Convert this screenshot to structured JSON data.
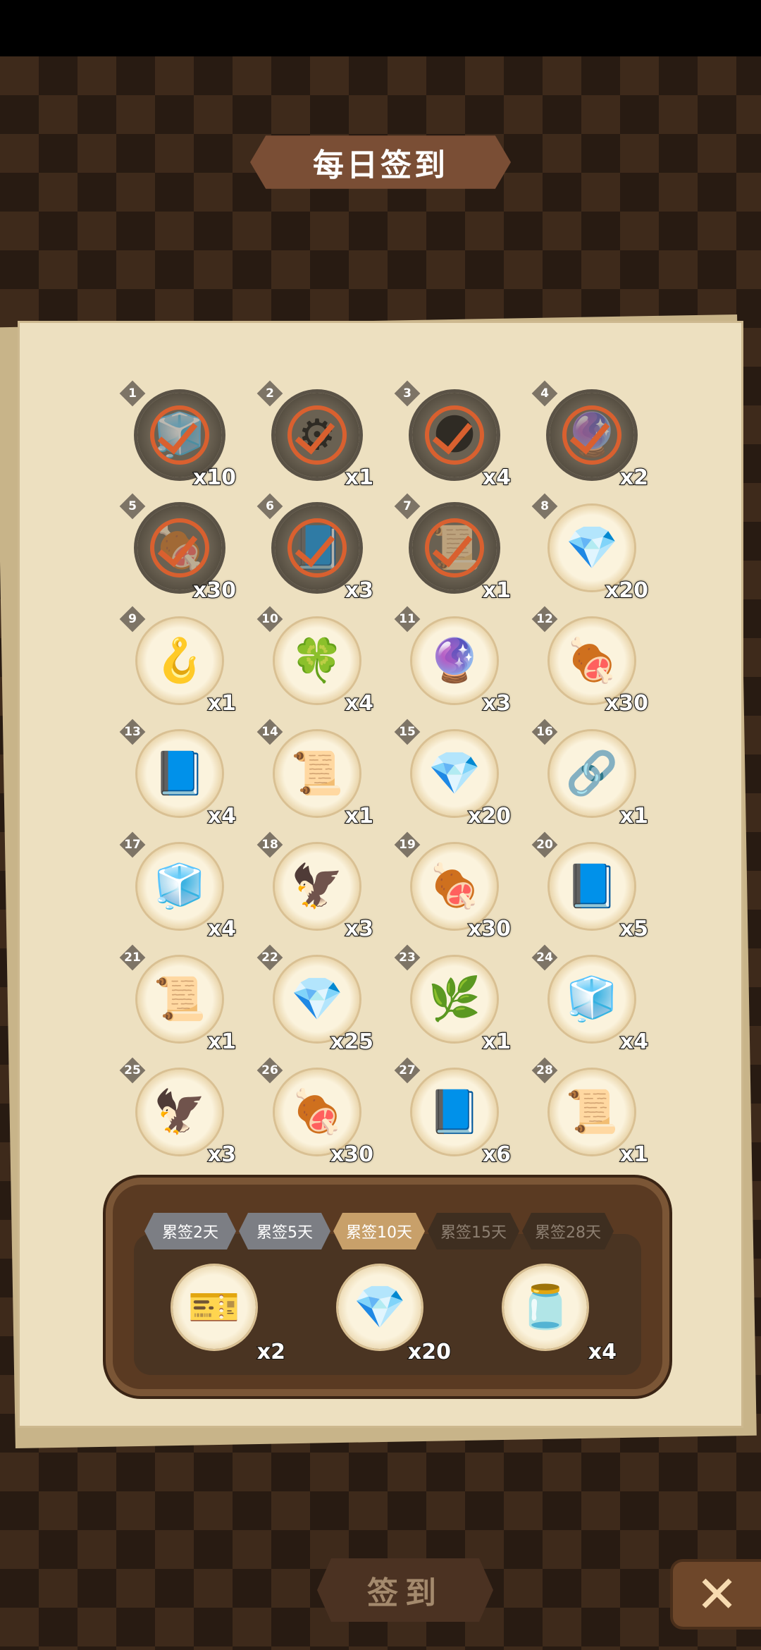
{
  "title": "每日签到",
  "days": [
    {
      "day": "1",
      "qty": "x10",
      "icon": "🧊",
      "icon_name": "blue-cube-icon",
      "signed": true
    },
    {
      "day": "2",
      "qty": "x1",
      "icon": "⚙",
      "icon_name": "gear-part-icon",
      "signed": true
    },
    {
      "day": "3",
      "qty": "x4",
      "icon": "🌑",
      "icon_name": "dark-ore-icon",
      "signed": true
    },
    {
      "day": "4",
      "qty": "x2",
      "icon": "🔮",
      "icon_name": "flaming-purple-gem-icon",
      "signed": true
    },
    {
      "day": "5",
      "qty": "x30",
      "icon": "🍖",
      "icon_name": "meat-icon",
      "signed": true
    },
    {
      "day": "6",
      "qty": "x3",
      "icon": "📘",
      "icon_name": "blue-book-icon",
      "signed": true
    },
    {
      "day": "7",
      "qty": "x1",
      "icon": "📜",
      "icon_name": "scroll-i-icon",
      "signed": true
    },
    {
      "day": "8",
      "qty": "x20",
      "icon": "💎",
      "icon_name": "blue-crystal-icon",
      "signed": false
    },
    {
      "day": "9",
      "qty": "x1",
      "icon": "🪝",
      "icon_name": "hook-icon",
      "signed": false
    },
    {
      "day": "10",
      "qty": "x4",
      "icon": "🍀",
      "icon_name": "clover-icon",
      "signed": false
    },
    {
      "day": "11",
      "qty": "x3",
      "icon": "🔮",
      "icon_name": "flaming-purple-gem-icon",
      "signed": false
    },
    {
      "day": "12",
      "qty": "x30",
      "icon": "🍖",
      "icon_name": "meat-icon",
      "signed": false
    },
    {
      "day": "13",
      "qty": "x4",
      "icon": "📘",
      "icon_name": "blue-book-icon",
      "signed": false
    },
    {
      "day": "14",
      "qty": "x1",
      "icon": "📜",
      "icon_name": "scroll-ii-icon",
      "signed": false
    },
    {
      "day": "15",
      "qty": "x20",
      "icon": "💎",
      "icon_name": "blue-crystal-icon",
      "signed": false
    },
    {
      "day": "16",
      "qty": "x1",
      "icon": "🔗",
      "icon_name": "chain-icon",
      "signed": false
    },
    {
      "day": "17",
      "qty": "x4",
      "icon": "🧊",
      "icon_name": "ice-block-icon",
      "signed": false
    },
    {
      "day": "18",
      "qty": "x3",
      "icon": "🦅",
      "icon_name": "flaming-claw-icon",
      "signed": false
    },
    {
      "day": "19",
      "qty": "x30",
      "icon": "🍖",
      "icon_name": "meat-icon",
      "signed": false
    },
    {
      "day": "20",
      "qty": "x5",
      "icon": "📘",
      "icon_name": "blue-book-icon",
      "signed": false
    },
    {
      "day": "21",
      "qty": "x1",
      "icon": "📜",
      "icon_name": "scroll-ii-icon",
      "signed": false
    },
    {
      "day": "22",
      "qty": "x25",
      "icon": "💎",
      "icon_name": "blue-crystal-icon",
      "signed": false
    },
    {
      "day": "23",
      "qty": "x1",
      "icon": "🌿",
      "icon_name": "vine-icon",
      "signed": false
    },
    {
      "day": "24",
      "qty": "x4",
      "icon": "🧊",
      "icon_name": "ice-block-icon",
      "signed": false
    },
    {
      "day": "25",
      "qty": "x3",
      "icon": "🦅",
      "icon_name": "flaming-claw-icon",
      "signed": false
    },
    {
      "day": "26",
      "qty": "x30",
      "icon": "🍖",
      "icon_name": "meat-icon",
      "signed": false
    },
    {
      "day": "27",
      "qty": "x6",
      "icon": "📘",
      "icon_name": "blue-book-icon",
      "signed": false
    },
    {
      "day": "28",
      "qty": "x1",
      "icon": "📜",
      "icon_name": "scroll-iii-icon",
      "signed": false
    }
  ],
  "bonus": {
    "tabs": [
      {
        "label": "累签2天",
        "state": "done"
      },
      {
        "label": "累签5天",
        "state": "done"
      },
      {
        "label": "累签10天",
        "state": "active"
      },
      {
        "label": "累签15天",
        "state": "locked"
      },
      {
        "label": "累签28天",
        "state": "locked"
      }
    ],
    "rewards": [
      {
        "qty": "x2",
        "icon": "🎫",
        "icon_name": "ticket-icon"
      },
      {
        "qty": "x20",
        "icon": "💎",
        "icon_name": "blue-crystal-icon"
      },
      {
        "qty": "x4",
        "icon": "🫙",
        "icon_name": "heart-potion-jar-icon"
      }
    ]
  },
  "sign_button": "签到",
  "close_button": "✕"
}
